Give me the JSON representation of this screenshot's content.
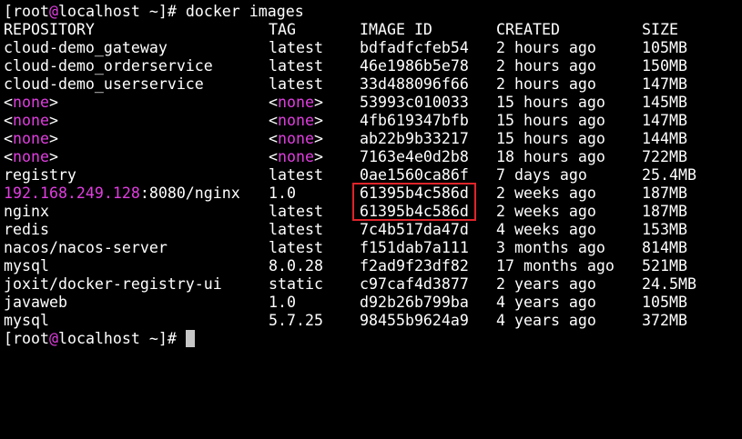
{
  "prompt": {
    "open_bracket": "[",
    "user": "root",
    "at": "@",
    "host": "localhost",
    "rest": " ~]# ",
    "command": "docker images"
  },
  "headers": {
    "repository": "REPOSITORY",
    "tag": "TAG",
    "image_id": "IMAGE ID",
    "created": "CREATED",
    "size": "SIZE"
  },
  "rows": [
    {
      "repository": "cloud-demo_gateway",
      "tag": "latest",
      "image_id": "bdfadfcfeb54",
      "created": "2 hours ago",
      "size": "105MB"
    },
    {
      "repository": "cloud-demo_orderservice",
      "tag": "latest",
      "image_id": "46e1986b5e78",
      "created": "2 hours ago",
      "size": "150MB"
    },
    {
      "repository": "cloud-demo_userservice",
      "tag": "latest",
      "image_id": "33d488096f66",
      "created": "2 hours ago",
      "size": "147MB"
    },
    {
      "repository_prefix": "<",
      "repository_none": "none",
      "repository_suffix": ">",
      "tag_prefix": "<",
      "tag_none": "none",
      "tag_suffix": ">",
      "image_id": "53993c010033",
      "created": "15 hours ago",
      "size": "145MB"
    },
    {
      "repository_prefix": "<",
      "repository_none": "none",
      "repository_suffix": ">",
      "tag_prefix": "<",
      "tag_none": "none",
      "tag_suffix": ">",
      "image_id": "4fb619347bfb",
      "created": "15 hours ago",
      "size": "147MB"
    },
    {
      "repository_prefix": "<",
      "repository_none": "none",
      "repository_suffix": ">",
      "tag_prefix": "<",
      "tag_none": "none",
      "tag_suffix": ">",
      "image_id": "ab22b9b33217",
      "created": "15 hours ago",
      "size": "144MB"
    },
    {
      "repository_prefix": "<",
      "repository_none": "none",
      "repository_suffix": ">",
      "tag_prefix": "<",
      "tag_none": "none",
      "tag_suffix": ">",
      "image_id": "7163e4e0d2b8",
      "created": "18 hours ago",
      "size": "722MB"
    },
    {
      "repository": "registry",
      "tag": "latest",
      "image_id": "0ae1560ca86f",
      "created": "7 days ago",
      "size": "25.4MB"
    },
    {
      "repository_ip": "192.168.249.128",
      "repository_rest": ":8080/nginx",
      "tag": "1.0",
      "image_id": "61395b4c586d",
      "created": "2 weeks ago",
      "size": "187MB"
    },
    {
      "repository": "nginx",
      "tag": "latest",
      "image_id": "61395b4c586d",
      "created": "2 weeks ago",
      "size": "187MB"
    },
    {
      "repository": "redis",
      "tag": "latest",
      "image_id": "7c4b517da47d",
      "created": "4 weeks ago",
      "size": "153MB"
    },
    {
      "repository": "nacos/nacos-server",
      "tag": "latest",
      "image_id": "f151dab7a111",
      "created": "3 months ago",
      "size": "814MB"
    },
    {
      "repository": "mysql",
      "tag": "8.0.28",
      "image_id": "f2ad9f23df82",
      "created": "17 months ago",
      "size": "521MB"
    },
    {
      "repository": "joxit/docker-registry-ui",
      "tag": "static",
      "image_id": "c97caf4d3877",
      "created": "2 years ago",
      "size": "24.5MB"
    },
    {
      "repository": "javaweb",
      "tag": "1.0",
      "image_id": "d92b26b799ba",
      "created": "4 years ago",
      "size": "105MB"
    },
    {
      "repository": "mysql",
      "tag": "5.7.25",
      "image_id": "98455b9624a9",
      "created": "4 years ago",
      "size": "372MB"
    }
  ],
  "colors": {
    "background": "#000000",
    "text": "#ffffff",
    "magenta": "#e03ee0",
    "highlight_border": "#e0242a",
    "cursor": "#c7c7c7"
  }
}
